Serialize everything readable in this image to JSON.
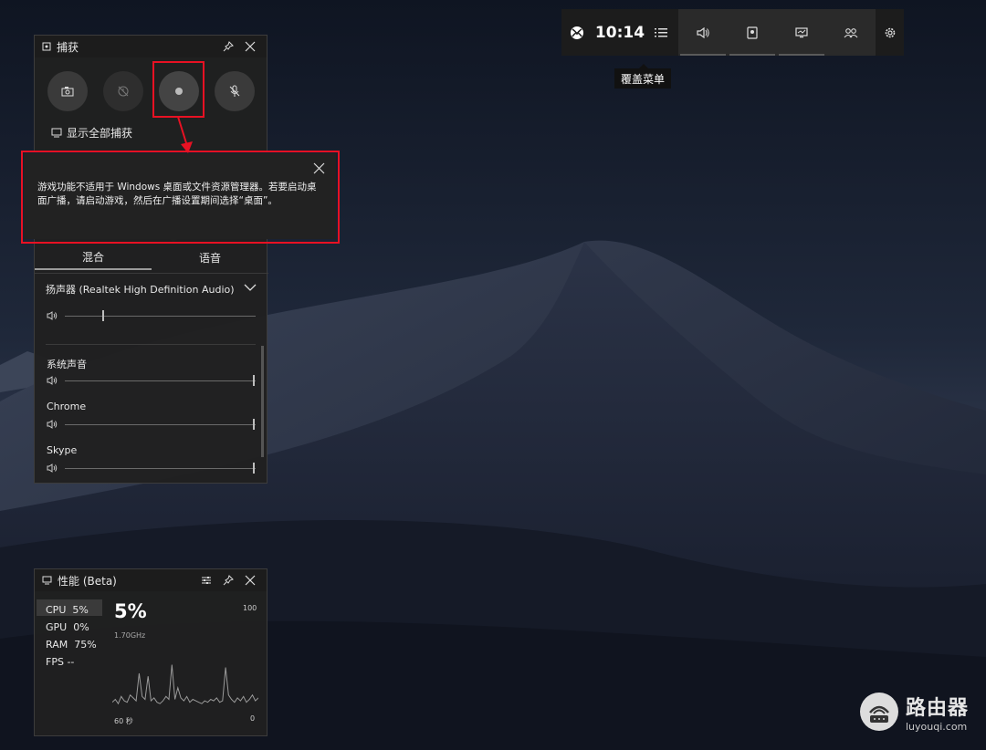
{
  "xbox_bar": {
    "time": "10:14",
    "tooltip": "覆盖菜单"
  },
  "capture": {
    "title": "捕获",
    "show_all": "显示全部捕获"
  },
  "popup": {
    "message": "游戏功能不适用于 Windows 桌面或文件资源管理器。若要启动桌面广播，请启动游戏，然后在广播设置期间选择“桌面”。"
  },
  "audio": {
    "tabs": [
      "混合",
      "语音"
    ],
    "device": "扬声器 (Realtek High Definition Audio)",
    "master_level": 0.2,
    "apps": [
      {
        "name": "系统声音",
        "level": 1.0
      },
      {
        "name": "Chrome",
        "level": 1.0
      },
      {
        "name": "Skype",
        "level": 1.0
      }
    ]
  },
  "performance": {
    "title": "性能 (Beta)",
    "metrics": [
      {
        "label": "CPU",
        "value": "5%"
      },
      {
        "label": "GPU",
        "value": "0%"
      },
      {
        "label": "RAM",
        "value": "75%"
      },
      {
        "label": "FPS",
        "value": "--"
      }
    ],
    "big_value": "5%",
    "freq": "1.70GHz",
    "max": "100",
    "min": "0",
    "time_label": "60 秒",
    "graph": [
      4,
      6,
      3,
      8,
      5,
      4,
      9,
      7,
      5,
      24,
      8,
      6,
      22,
      5,
      7,
      4,
      3,
      5,
      8,
      6,
      30,
      6,
      14,
      7,
      5,
      8,
      4,
      6,
      5,
      4,
      3,
      5,
      4,
      6,
      5,
      7,
      4,
      5,
      28,
      9,
      6,
      4,
      7,
      5,
      8,
      4,
      6,
      9,
      5,
      7
    ]
  },
  "watermark": {
    "brand": "路由器",
    "url": "luyouqi.com"
  },
  "colors": {
    "highlight": "#e81123",
    "panel": "#202020",
    "accent": "#ffffff"
  }
}
